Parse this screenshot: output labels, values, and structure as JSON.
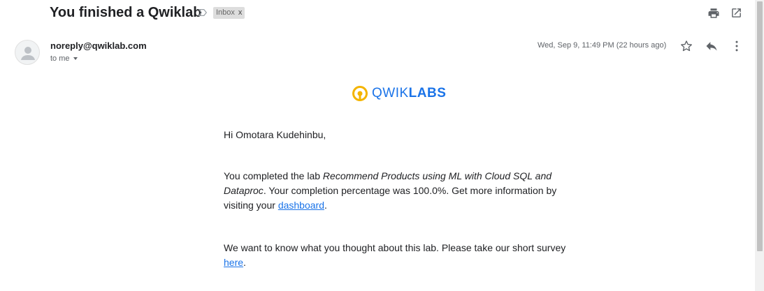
{
  "message": {
    "subject": "You finished a Qwiklab",
    "label": "Inbox",
    "label_close": "x"
  },
  "header": {
    "sender": "noreply@qwiklab.com",
    "recipient": "to me",
    "date": "Wed, Sep 9, 11:49 PM (22 hours ago)"
  },
  "logo": {
    "text_light": "QWIK",
    "text_bold": "LABS",
    "mark_color": "#f4b400",
    "text_color": "#1a73e8"
  },
  "body": {
    "greeting": "Hi Omotara Kudehinbu,",
    "para1_prefix": "You completed the lab ",
    "lab_name": "Recommend Products using ML with Cloud SQL and Dataproc",
    "para1_middle": ". Your completion percentage was 100.0%. Get more information by visiting your ",
    "dashboard_link": "dashboard",
    "para1_suffix": ".",
    "para2_prefix": "We want to know what you thought about this lab. Please take our short survey ",
    "survey_link": "here",
    "para2_suffix": "."
  },
  "icons": [
    "important-marker-icon",
    "print-icon",
    "open-in-new-window-icon",
    "avatar-person-icon",
    "star-icon",
    "reply-icon",
    "more-vert-icon"
  ]
}
